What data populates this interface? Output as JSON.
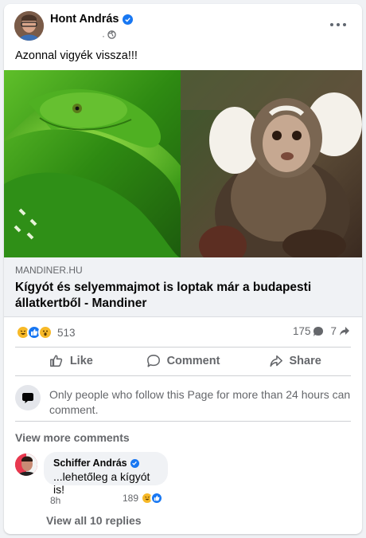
{
  "post": {
    "author": "Hont András",
    "text": "Azonnal vigyék vissza!!!",
    "meta_dot": "·"
  },
  "link": {
    "domain": "MANDINER.HU",
    "title": "Kígyót és selyemmajmot is loptak már a budapesti állatkertből - Mandiner"
  },
  "stats": {
    "reactions": "513",
    "comments": "175",
    "shares": "7"
  },
  "actions": {
    "like": "Like",
    "comment": "Comment",
    "share": "Share"
  },
  "notice": {
    "text": "Only people who follow this Page for more than 24 hours can comment."
  },
  "comments": {
    "view_more": "View more comments",
    "items": [
      {
        "author": "Schiffer András",
        "text": "...lehetőleg a kígyót is!",
        "time": "8h",
        "reactions": "189"
      }
    ],
    "view_replies": "View all 10 replies"
  },
  "colors": {
    "brand_blue": "#1877f2",
    "secondary_text": "#65676b",
    "haha_yellow": "#f7b928",
    "like_blue": "#1877f2"
  },
  "icons": [
    "verified-icon",
    "globe-icon",
    "more-icon",
    "like-icon",
    "comment-icon",
    "share-icon",
    "chat-bubble-icon",
    "haha-reaction-icon",
    "like-reaction-icon",
    "wow-reaction-icon"
  ]
}
